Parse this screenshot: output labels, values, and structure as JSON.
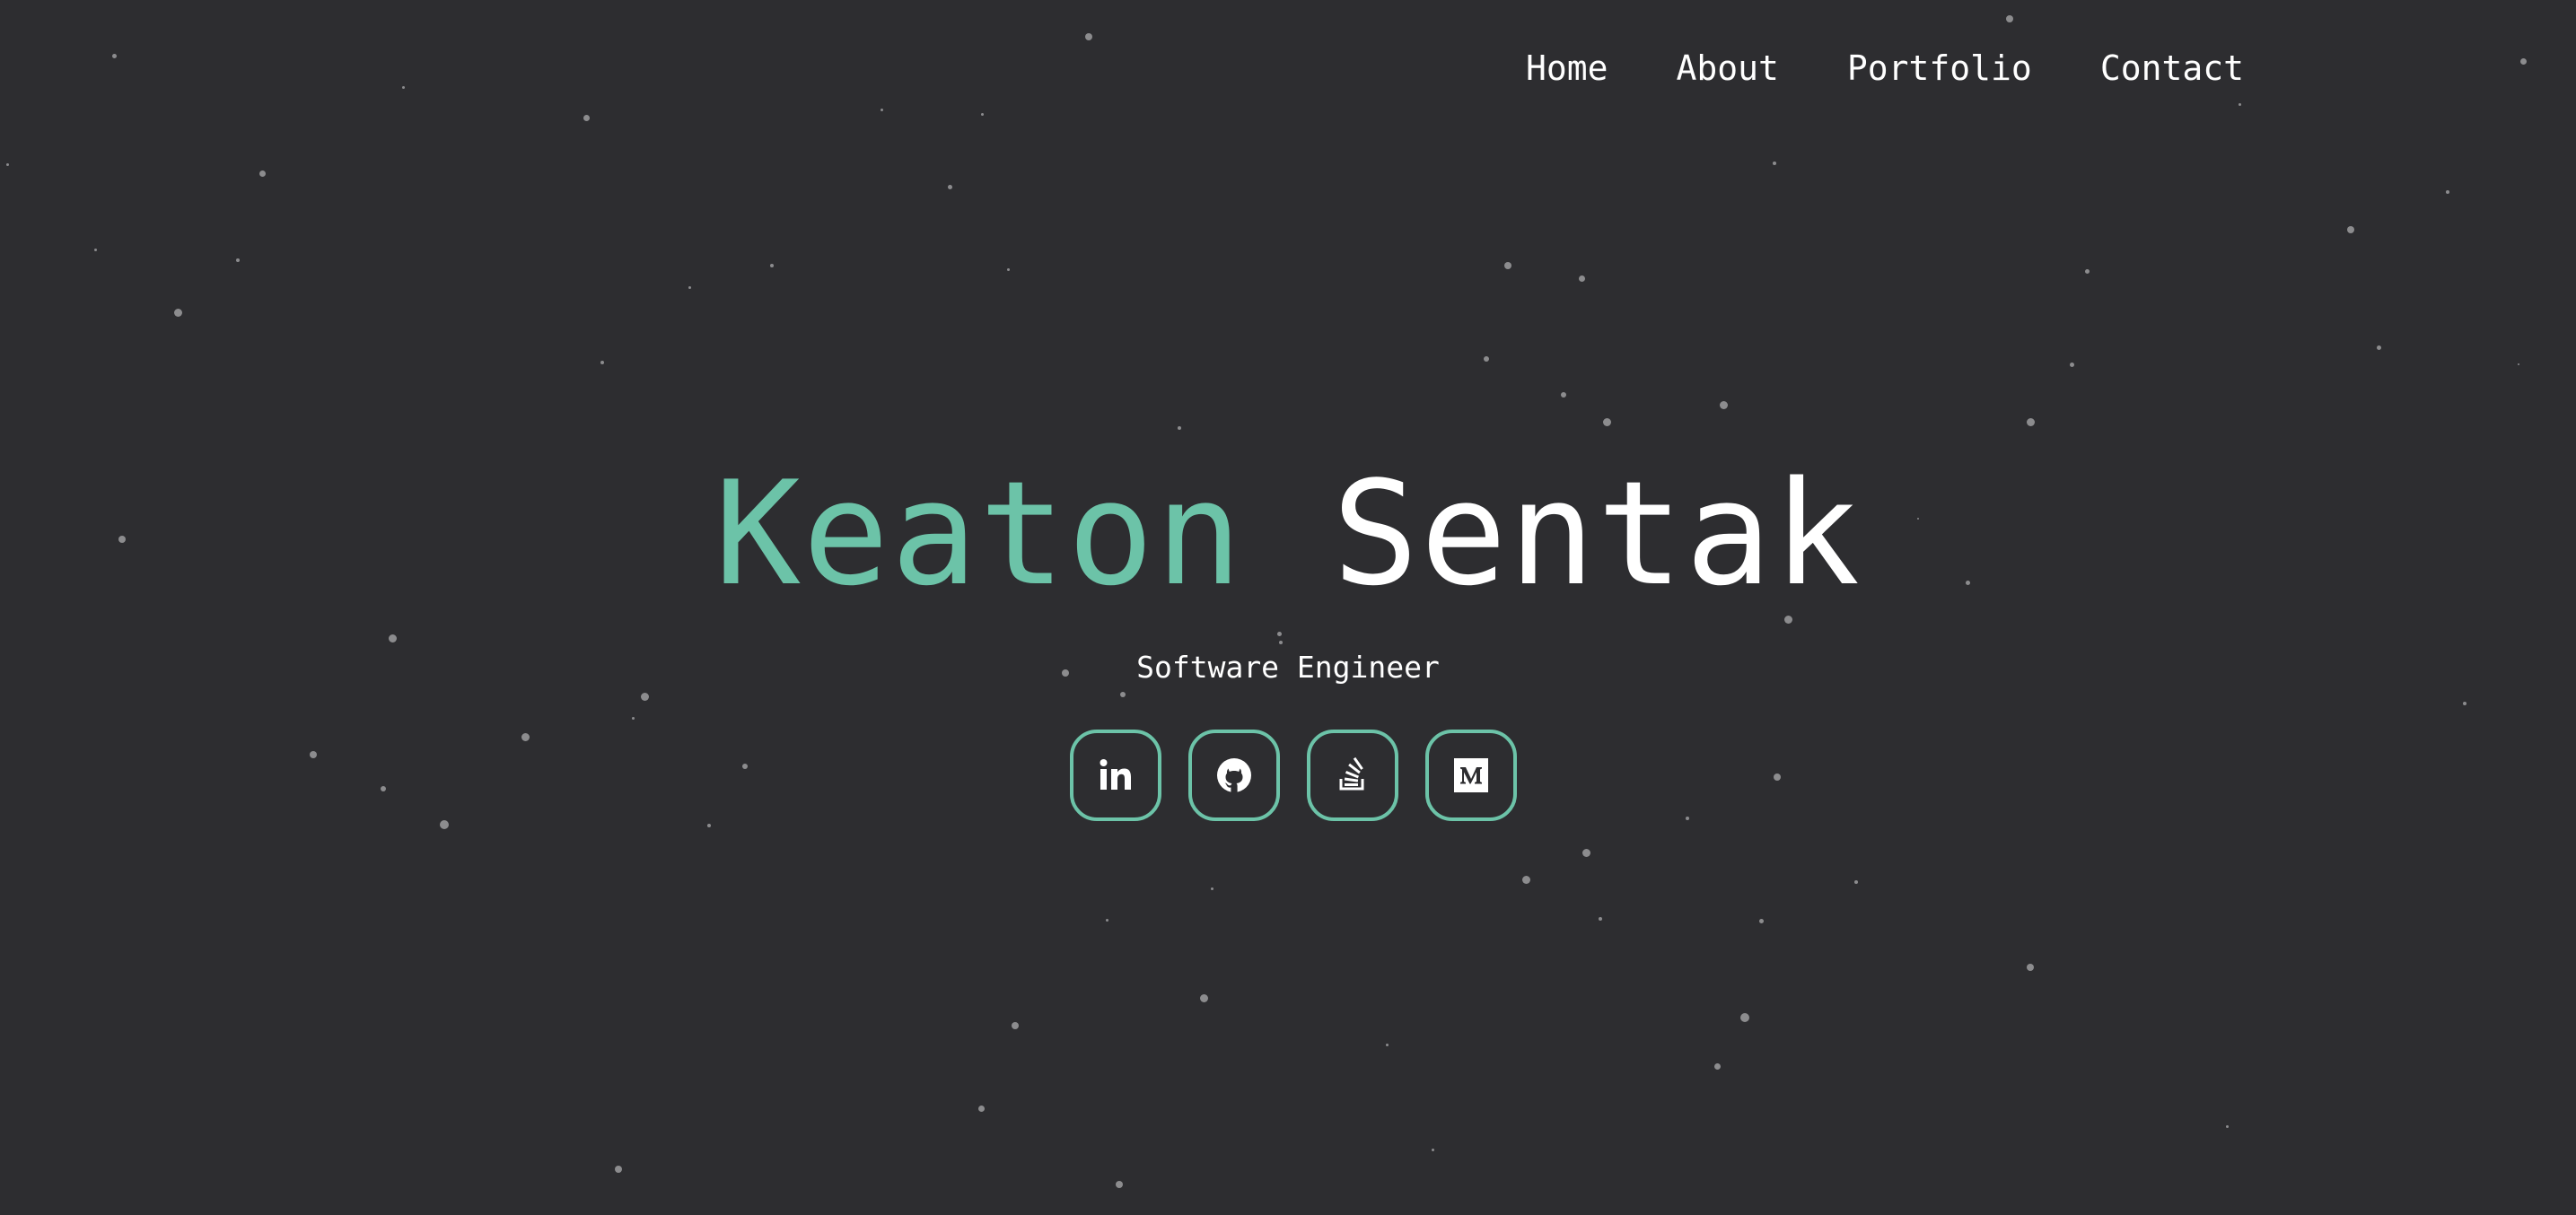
{
  "nav": {
    "items": [
      "Home",
      "About",
      "Portfolio",
      "Contact"
    ]
  },
  "hero": {
    "first_name": "Keaton",
    "last_name": "Sentak",
    "subtitle": "Software Engineer"
  },
  "socials": [
    {
      "icon": "linkedin-icon"
    },
    {
      "icon": "github-icon"
    },
    {
      "icon": "stackoverflow-icon"
    },
    {
      "icon": "medium-icon"
    }
  ],
  "colors": {
    "background": "#2d2d30",
    "accent": "#6cc3a8",
    "text": "#ffffff",
    "particle": "#8c8c8e"
  }
}
